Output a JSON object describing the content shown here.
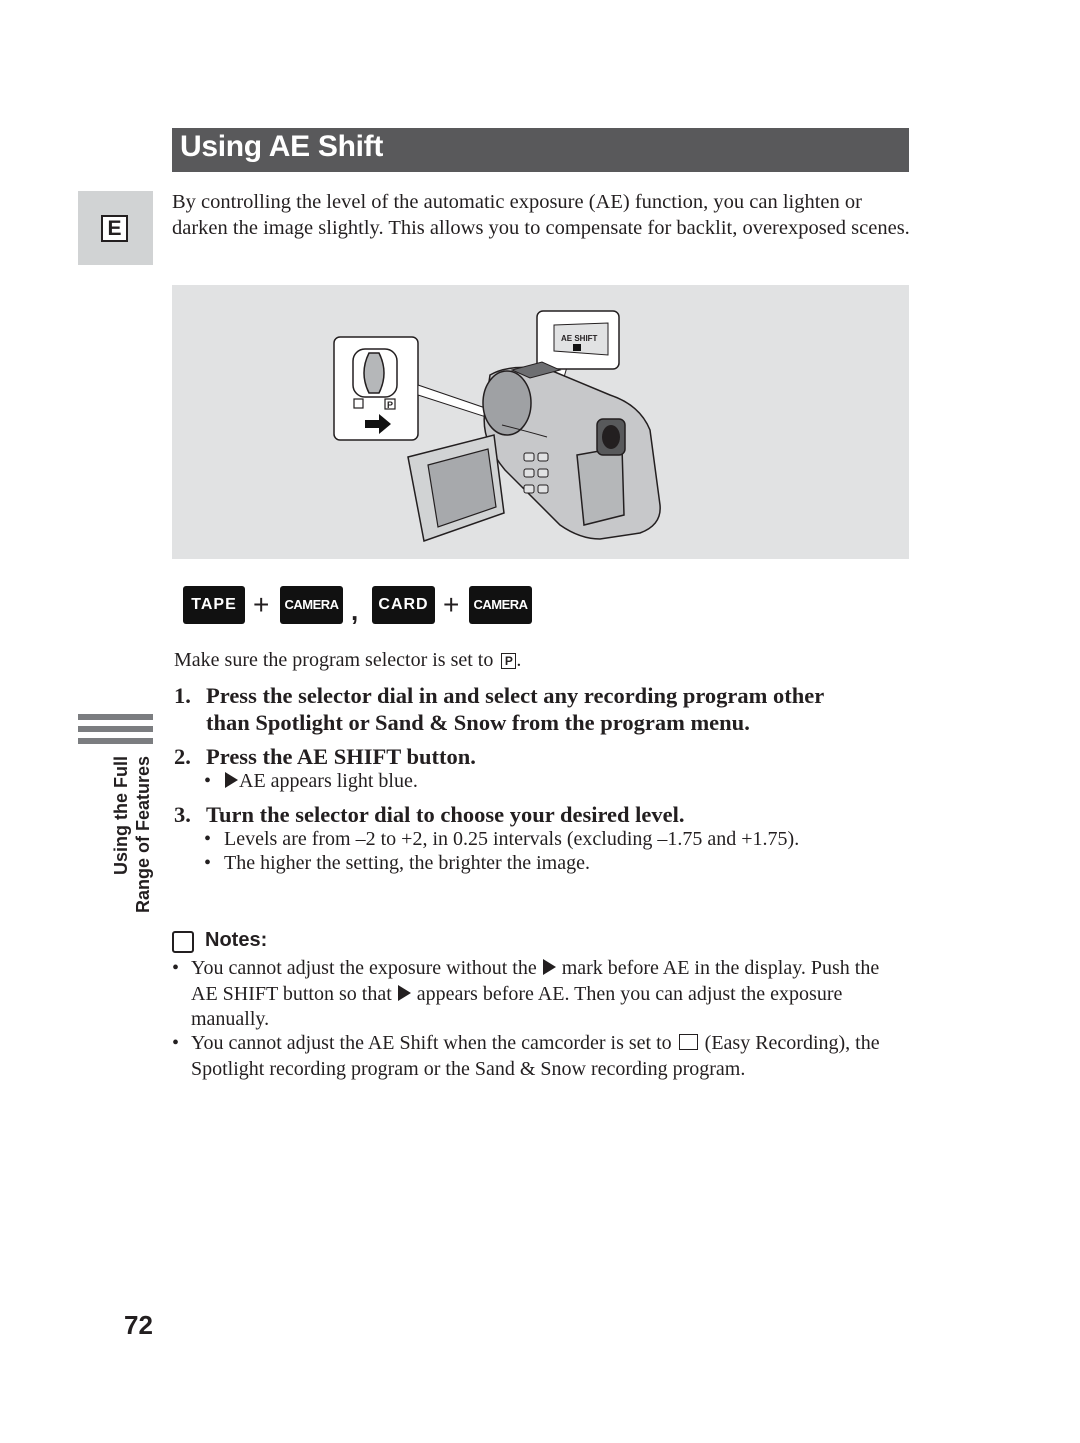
{
  "header": {
    "title": "Using AE Shift",
    "language_tab": "E"
  },
  "intro": "By controlling the level of the automatic exposure (AE) function, you can lighten or darken the image slightly. This allows you to compensate for backlit, overexposed scenes.",
  "figure": {
    "callout_button_label": "AE SHIFT",
    "selector_marks": [
      "easy-recording",
      "P"
    ],
    "description": "Camcorder with program selector and AE SHIFT button callouts"
  },
  "modes": {
    "items": [
      {
        "first": "TAPE",
        "second": "CAMERA"
      },
      {
        "first": "CARD",
        "second": "CAMERA"
      }
    ],
    "plus": "+",
    "separator": ","
  },
  "pre_step": {
    "text": "Make sure the program selector is set to",
    "mark": "P",
    "end": "."
  },
  "steps": [
    {
      "num": "1.",
      "line1": "Press the selector dial in and select any recording program other",
      "line2": "than Spotlight or Sand & Snow from the program menu.",
      "bullets": []
    },
    {
      "num": "2.",
      "line1": "Press the AE SHIFT button.",
      "bullets": [
        "AE appears light blue."
      ]
    },
    {
      "num": "3.",
      "line1": "Turn the selector dial to choose your desired level.",
      "bullets": [
        "Levels are from –2 to +2, in 0.25 intervals (excluding –1.75 and +1.75).",
        "The higher the setting, the brighter the image."
      ]
    }
  ],
  "bullet_char": "•",
  "side": {
    "line1": "Using the Full",
    "line2": "Range of Features"
  },
  "notes": {
    "heading": "Notes:",
    "n1_a": "You cannot adjust the exposure without the",
    "n1_b": "mark before AE in the display. Push the AE SHIFT button so that",
    "n1_c": "appears before AE. Then you can adjust the exposure manually.",
    "n2_a": "You cannot adjust the AE Shift when the camcorder is set to",
    "n2_b": "(Easy Recording), the Spotlight recording program or the Sand & Snow recording program."
  },
  "page_number": "72"
}
